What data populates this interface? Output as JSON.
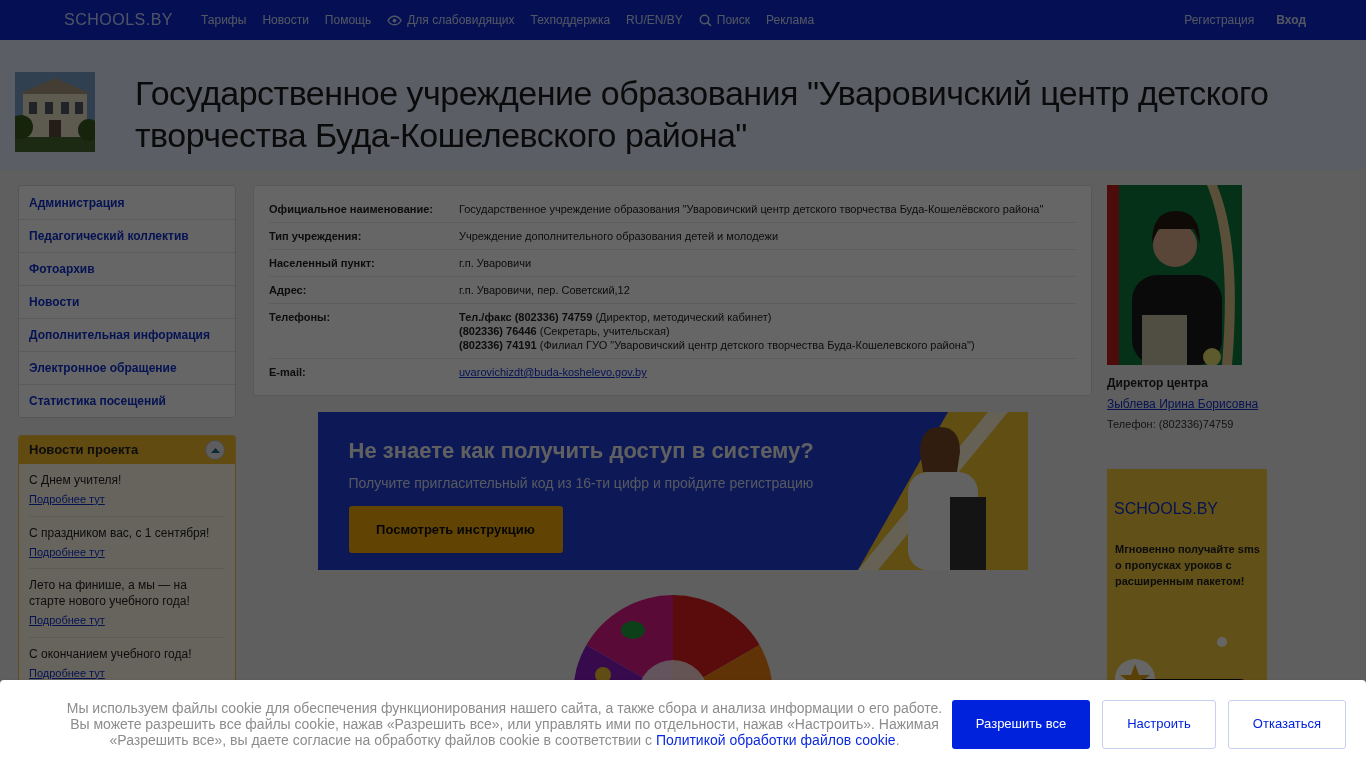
{
  "topbar": {
    "logo": "SCHOOLS.BY",
    "links": [
      {
        "label": "Тарифы",
        "kind": "text"
      },
      {
        "label": "Новости",
        "kind": "text"
      },
      {
        "label": "Помощь",
        "kind": "text"
      },
      {
        "label": "Для слабовидящих",
        "kind": "accessibility"
      },
      {
        "label": "Техподдержка",
        "kind": "text"
      },
      {
        "label": "RU/EN/BY",
        "kind": "text"
      },
      {
        "label": "Поиск",
        "kind": "search"
      },
      {
        "label": "Реклама",
        "kind": "text"
      }
    ],
    "auth": [
      {
        "label": "Регистрация",
        "bold": false
      },
      {
        "label": "Вход",
        "bold": true
      }
    ]
  },
  "header": {
    "title": "Государственное учреждение образования \"Уваровичский центр детского творчества Буда-Кошелевского района\""
  },
  "sidebar": {
    "items": [
      "Администрация",
      "Педагогический коллектив",
      "Фотоархив",
      "Новости",
      "Дополнительная информация",
      "Электронное обращение",
      "Статистика посещений"
    ]
  },
  "project_news": {
    "title": "Новости проекта",
    "expanded": true,
    "items": [
      {
        "title": "С Днем учителя!",
        "link": "Подробнее тут"
      },
      {
        "title": "С праздником вас, с 1 сентября!",
        "link": "Подробнее тут"
      },
      {
        "title": "Лето на финише, а мы — на старте нового учебного года!",
        "link": "Подробнее тут"
      },
      {
        "title": "С окончанием учебного года!",
        "link": "Подробнее тут"
      }
    ]
  },
  "info": {
    "rows": [
      {
        "label": "Официальное наименование:",
        "kind": "text",
        "lines": [
          "Государственное учреждение образования \"Уваровичский центр детского творчества Буда-Кошелёвского района\""
        ]
      },
      {
        "label": "Тип учреждения:",
        "kind": "text",
        "lines": [
          "Учреждение дополнительного образования детей и молодежи"
        ]
      },
      {
        "label": "Населенный пункт:",
        "kind": "text",
        "lines": [
          "г.п. Уваровичи"
        ]
      },
      {
        "label": "Адрес:",
        "kind": "text",
        "lines": [
          "г.п. Уваровичи, пер. Советский,12"
        ]
      },
      {
        "label": "Телефоны:",
        "kind": "text",
        "lines": [
          "**Тел./факс (802336) 74759** (Директор, методический кабинет)",
          "**(802336) 76446** (Секретарь, учительская)",
          "**(802336) 74191** (Филиал ГУО \"Уваровичский центр детского творчества Буда-Кошелевского района\")"
        ]
      },
      {
        "label": "E-mail:",
        "kind": "link",
        "lines": [
          "uvarovichizdt@buda-koshelevo.gov.by"
        ]
      }
    ]
  },
  "banner": {
    "heading": "Не знаете как получить доступ в систему?",
    "subtext": "Получите пригласительный код из 16-ти цифр и пройдите регистрацию",
    "button": "Посмотреть инструкцию"
  },
  "director": {
    "role": "Директор центра",
    "name": "Зыблева Ирина Борисовна",
    "phone": "Телефон: (802336)74759"
  },
  "ad": {
    "logo": "SCHOOLS.BY",
    "text": "Мгновенно получайте sms о пропусках уроков с расширенным пакетом!"
  },
  "cookie": {
    "text": "Мы используем файлы cookie для обеспечения функционирования нашего сайта, а также сбора и анализа информации о его работе. Вы можете разрешить все файлы cookie, нажав «Разрешить все», или управлять ими по отдельности, нажав «Настроить». Нажимая «Разрешить все», вы даете согласие на обработку файлов cookie в соответствии с",
    "link": "Политикой обработки файлов cookie",
    "end": ".",
    "buttons": [
      {
        "label": "Разрешить все",
        "primary": true
      },
      {
        "label": "Настроить",
        "primary": false
      },
      {
        "label": "Отказаться",
        "primary": false
      }
    ]
  }
}
